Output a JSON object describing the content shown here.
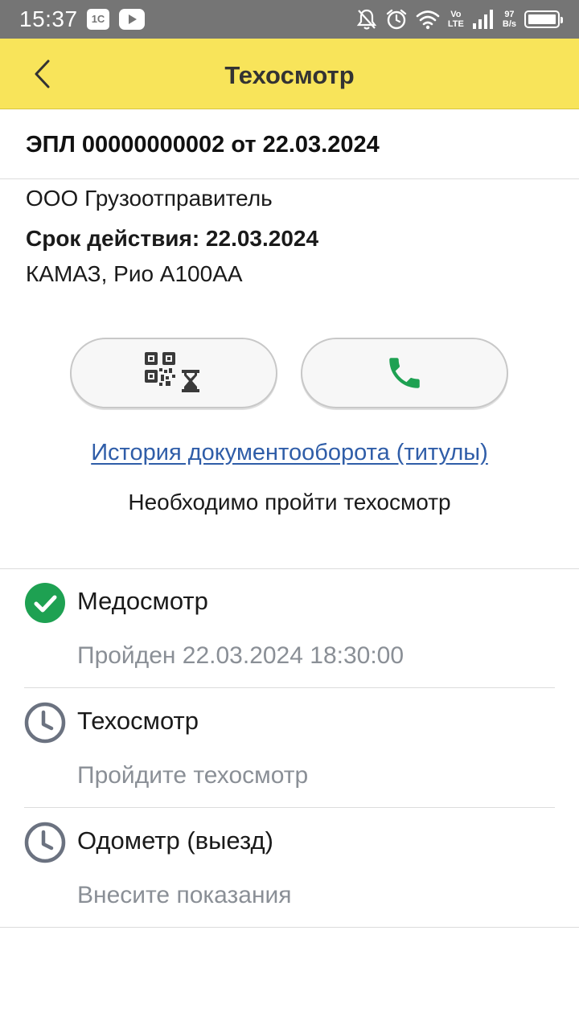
{
  "status_bar": {
    "time": "15:37",
    "app_badge": "1С",
    "network_label_top": "Vo",
    "network_label_bottom": "LTE",
    "speed_value": "97",
    "speed_unit": "B/s"
  },
  "app_bar": {
    "title": "Техосмотр"
  },
  "document": {
    "title": "ЭПЛ 00000000002 от 22.03.2024",
    "organization": "ООО Грузоотправитель",
    "validity": "Срок действия: 22.03.2024",
    "vehicle": "КАМАЗ, Рио А100АА"
  },
  "actions": {
    "qr_icon": "qr-code-pending-icon",
    "phone_icon": "phone-icon",
    "phone_color": "#1ea152"
  },
  "history_link": "История документооборота (титулы)",
  "notice": "Необходимо пройти техосмотр",
  "steps": [
    {
      "title": "Медосмотр",
      "subtitle": "Пройден 22.03.2024 18:30:00",
      "status_icon": "check-circle-icon",
      "status_color": "#1ea152"
    },
    {
      "title": "Техосмотр",
      "subtitle": "Пройдите техосмотр",
      "status_icon": "clock-icon",
      "status_color": "#6b7280"
    },
    {
      "title": "Одометр (выезд)",
      "subtitle": "Внесите показания",
      "status_icon": "clock-icon",
      "status_color": "#6b7280"
    }
  ],
  "colors": {
    "app_bar": "#f8e45a",
    "link": "#2f5da8",
    "muted_text": "#8a8f96"
  }
}
